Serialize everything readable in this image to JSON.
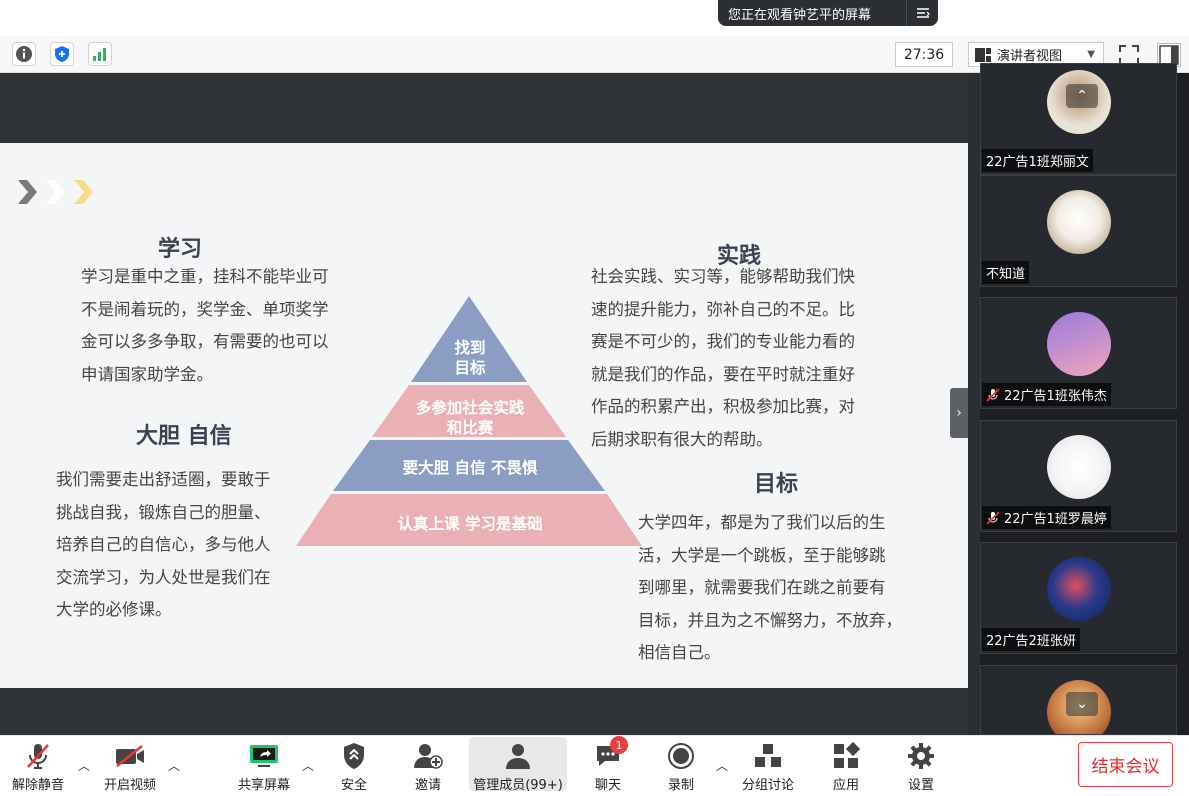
{
  "banner": {
    "text": "您正在观看钟艺平的屏幕"
  },
  "top_bar": {
    "timer": "27:36",
    "view_mode": "演讲者视图"
  },
  "slide": {
    "sections": [
      {
        "heading": "学习",
        "lines": [
          "学习是重中之重，挂科不能毕业可",
          "不是闹着玩的，奖学金、单项奖学",
          "金可以多多争取，有需要的也可以",
          "申请国家助学金。"
        ]
      },
      {
        "heading": "大胆 自信",
        "lines": [
          "我们需要走出舒适圈，要敢于",
          "挑战自我，锻炼自己的胆量、",
          "培养自己的自信心，多与他人",
          "交流学习，为人处世是我们在",
          "大学的必修课。"
        ]
      },
      {
        "heading": "实践",
        "lines": [
          "社会实践、实习等，能够帮助我们快",
          "速的提升能力，弥补自己的不足。比",
          "赛是不可少的，我们的专业能力看的",
          "就是我们的作品，要在平时就注重好",
          "作品的积累产出，积极参加比赛，对",
          "后期求职有很大的帮助。"
        ]
      },
      {
        "heading": "目标",
        "lines": [
          "大学四年，都是为了我们以后的生",
          "活，大学是一个跳板，至于能够跳",
          "到哪里，就需要我们在跳之前要有",
          "目标，并且为之不懈努力，不放弃，",
          "相信自己。"
        ]
      }
    ],
    "pyramid": [
      {
        "line1": "找到",
        "line2": "目标",
        "color": "#8b9dc3"
      },
      {
        "line1": "多参加社会实践",
        "line2": "和比赛",
        "color": "#e9b1b5"
      },
      {
        "line1": "要大胆  自信  不畏惧",
        "line2": "",
        "color": "#8b9dc3"
      },
      {
        "line1": "认真上课  学习是基础",
        "line2": "",
        "color": "#e9b1b5"
      }
    ]
  },
  "participants": [
    {
      "name": "22广告1班郑丽文",
      "muted": false
    },
    {
      "name": "不知道",
      "muted": false
    },
    {
      "name": "22广告1班张伟杰",
      "muted": true
    },
    {
      "name": "22广告1班罗晨婷",
      "muted": true
    },
    {
      "name": "22广告2班张妍",
      "muted": false
    },
    {
      "name": "",
      "muted": false
    }
  ],
  "toolbar": {
    "unmute": "解除静音",
    "video": "开启视频",
    "share": "共享屏幕",
    "security": "安全",
    "invite": "邀请",
    "members": "管理成员(99+)",
    "chat": "聊天",
    "chat_badge": "1",
    "record": "录制",
    "breakout": "分组讨论",
    "apps": "应用",
    "settings": "设置",
    "end": "结束会议"
  }
}
